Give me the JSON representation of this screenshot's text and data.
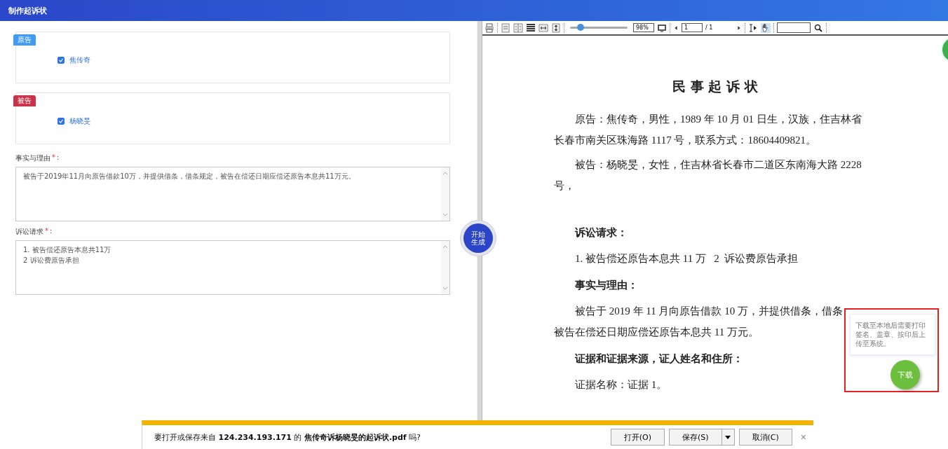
{
  "window": {
    "title": "制作起诉状"
  },
  "parties": [
    {
      "role": "原告",
      "color": "#3f9bf5",
      "name": "焦传奇",
      "checked": true
    },
    {
      "role": "被告",
      "color": "#c9344b",
      "name": "杨晓旻",
      "checked": true
    }
  ],
  "fields": [
    {
      "label": "事实与理由",
      "required_mark": "*",
      "colon": ":",
      "value": "被告于2019年11月向原告借款10万，并提供借条，借条规定，被告在偿还日期应偿还原告本息共11万元。"
    },
    {
      "label": "诉讼请求",
      "required_mark": "*",
      "colon": ":",
      "value": "1. 被告偿还原告本息共11万\n2 诉讼费原告承担"
    }
  ],
  "generate_button": {
    "label": "开始生成"
  },
  "pdf_toolbar": {
    "zoom_slider": {
      "level": 0.18
    },
    "zoom": "98%",
    "page": "1",
    "page_total": "/ 1",
    "tools": [
      {
        "kind": "select-text",
        "selected": false
      },
      {
        "kind": "hand",
        "selected": true
      }
    ]
  },
  "document": {
    "title": "民 事 起 诉 状",
    "blocks": [
      {
        "kind": "paragraph",
        "lines": [
          "原告：焦传奇，男性，1989 年 10 月 01 日生，汉族，住吉林省",
          "长春市南关区珠海路 1117 号，联系方式：18604409821。"
        ]
      },
      {
        "kind": "paragraph",
        "lines": [
          "被告：杨晓旻，女性，住吉林省长春市二道区东南海大路 2228",
          "号，"
        ]
      },
      {
        "kind": "heading",
        "text": "诉讼请求："
      },
      {
        "kind": "paragraph",
        "lines": [
          "1. 被告偿还原告本息共 11 万   2  诉讼费原告承担"
        ]
      },
      {
        "kind": "heading",
        "text": "事实与理由："
      },
      {
        "kind": "paragraph",
        "lines": [
          "被告于 2019 年 11 月向原告借款 10 万，并提供借条，借条",
          "被告在偿还日期应偿还原告本息共 11 万元。"
        ]
      },
      {
        "kind": "heading",
        "text": "证据和证据来源，证人姓名和住所："
      },
      {
        "kind": "paragraph",
        "lines": [
          "证据名称：证据 1。"
        ]
      }
    ]
  },
  "download_tip": {
    "text": "下载至本地后需要打印签名、盖章、按印后上传至系统。",
    "button": "下载"
  },
  "download_bar": {
    "message": "要打开或保存来自 **124.234.193.171** 的 **焦传奇诉杨晓旻的起诉状.pdf** 吗?",
    "buttons": [
      {
        "label": "打开(O)",
        "dropdown": false
      },
      {
        "label": "保存(S)",
        "dropdown": true
      },
      {
        "label": "取消(C)",
        "dropdown": false
      }
    ],
    "close": "×"
  }
}
